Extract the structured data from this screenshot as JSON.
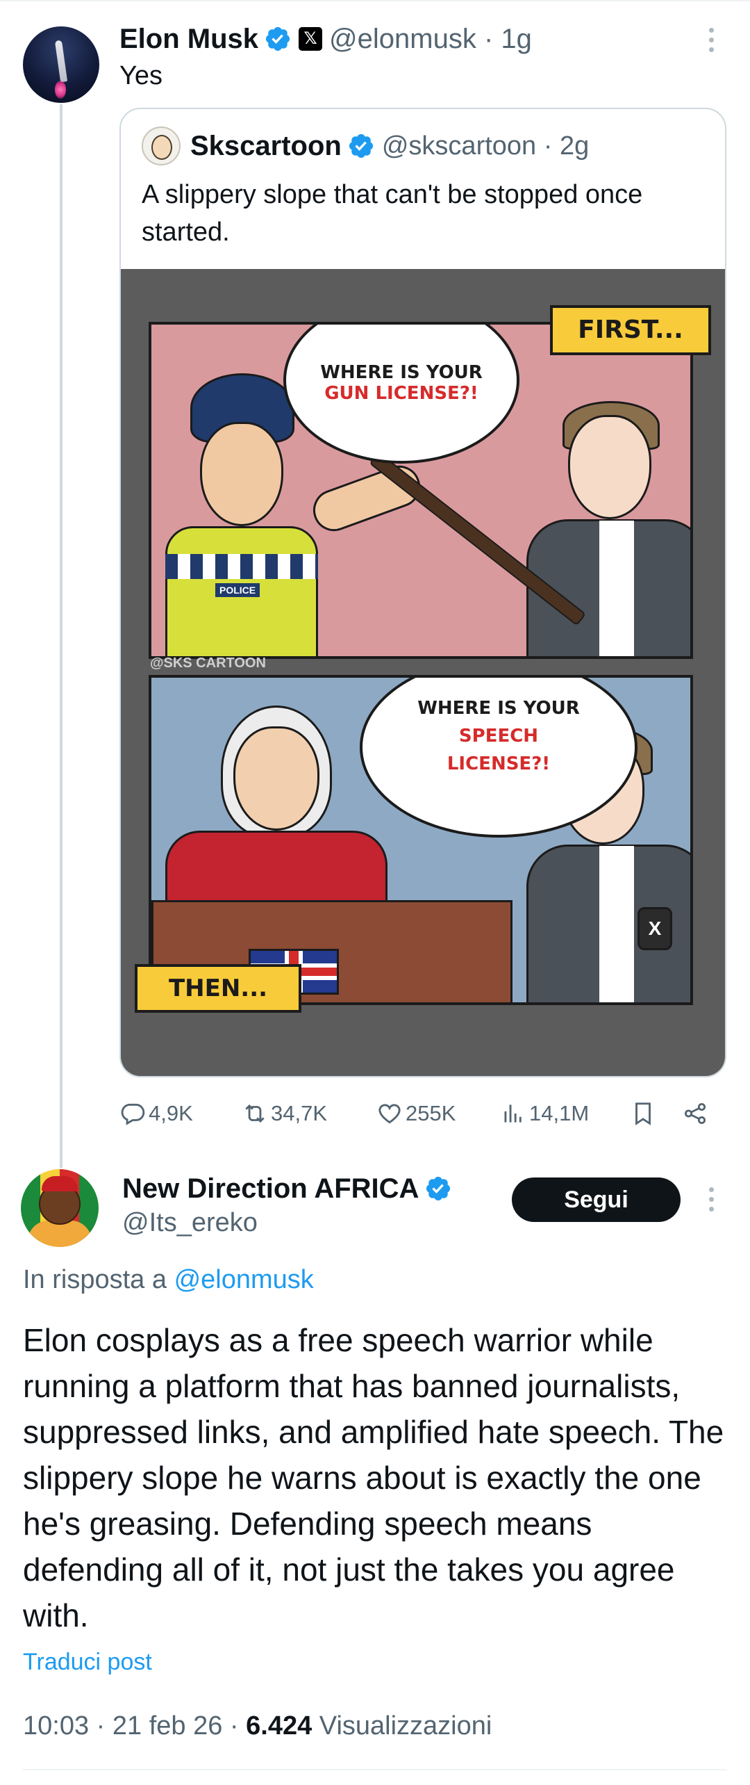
{
  "post1": {
    "name": "Elon Musk",
    "handle": "@elonmusk",
    "time": "1g",
    "text": "Yes",
    "quote": {
      "name": "Skscartoon",
      "handle": "@skscartoon",
      "time": "2g",
      "text": "A slippery slope that can't be stopped once started.",
      "cartoon": {
        "bubble1_line1": "WHERE IS YOUR",
        "bubble1_line2": "GUN LICENSE?!",
        "bubble2_line1": "WHERE IS YOUR",
        "bubble2_line2": "SPEECH",
        "bubble2_line3": "LICENSE?!",
        "caption1": "FIRST...",
        "caption2": "THEN...",
        "watermark": "@SKS CARTOON",
        "badge": "POLICE",
        "phone_glyph": "X"
      }
    },
    "stats": {
      "replies": "4,9K",
      "reposts": "34,7K",
      "likes": "255K",
      "views": "14,1M"
    }
  },
  "post2": {
    "name": "New Direction AFRICA",
    "handle": "@Its_ereko",
    "follow_label": "Segui",
    "reply_prefix": "In risposta a",
    "reply_mention": "@elonmusk",
    "text": "Elon cosplays as a free speech warrior while running a platform that has banned journalists, suppressed links, and amplified hate speech. The slippery slope he warns about is exactly the one he's greasing. Defending speech means defending all of it, not just the takes you agree with.",
    "translate_label": "Traduci post",
    "time": "10:03",
    "date": "21 feb 26",
    "views_count": "6.424",
    "views_label": "Visualizzazioni"
  },
  "colors": {
    "accent": "#1d9bf0",
    "text": "#0f1419",
    "secondary": "#536471"
  },
  "icons": [
    "verified-badge-icon",
    "x-logo-icon",
    "more-icon",
    "reply-icon",
    "repost-icon",
    "like-icon",
    "views-icon",
    "bookmark-icon",
    "share-icon"
  ]
}
